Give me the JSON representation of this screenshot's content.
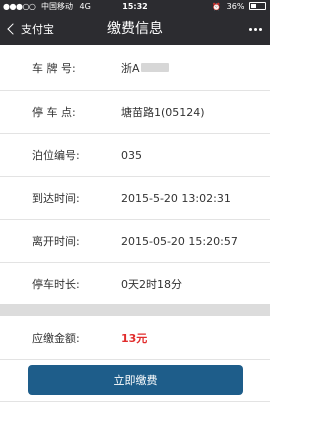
{
  "status_bar": {
    "carrier": "中国移动",
    "network": "4G",
    "time": "15:32",
    "battery_percent": "36%",
    "battery_level": 0.36
  },
  "nav": {
    "back_label": "支付宝",
    "title": "缴费信息"
  },
  "details": [
    {
      "label": "车 牌 号:",
      "value": "浙A"
    },
    {
      "label": "停 车 点:",
      "value": "塘苗路1(05124)"
    },
    {
      "label": "泊位编号:",
      "value": "035"
    },
    {
      "label": "到达时间:",
      "value": "2015-5-20 13:02:31"
    },
    {
      "label": "离开时间:",
      "value": "2015-05-20 15:20:57"
    },
    {
      "label": "停车时长:",
      "value": "0天2时18分"
    }
  ],
  "fee": {
    "label": "应缴金额:",
    "value": "13元",
    "color": "#e12c2c"
  },
  "pay_button": {
    "label": "立即缴费",
    "color": "#1e5d8a"
  },
  "icons": {
    "back": "chevron-left-icon",
    "more": "more-dots-icon",
    "alarm": "alarm-icon",
    "battery": "battery-icon"
  }
}
